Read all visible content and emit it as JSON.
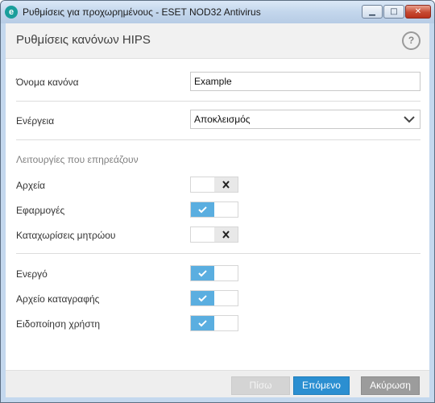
{
  "window": {
    "app_icon_letter": "e",
    "title": "Ρυθμίσεις για προχωρημένους - ESET NOD32 Antivirus",
    "minimize_glyph": "▁",
    "maximize_glyph": "□",
    "close_glyph": "✕"
  },
  "header": {
    "title": "Ρυθμίσεις κανόνων HIPS",
    "help_glyph": "?"
  },
  "form": {
    "rule_name_label": "Όνομα κανόνα",
    "rule_name_value": "Example",
    "action_label": "Ενέργεια",
    "action_value": "Αποκλεισμός"
  },
  "affected": {
    "section_title": "Λειτουργίες που επηρεάζουν",
    "items": [
      {
        "label": "Αρχεία",
        "enabled": false
      },
      {
        "label": "Εφαρμογές",
        "enabled": true
      },
      {
        "label": "Καταχωρίσεις μητρώου",
        "enabled": false
      }
    ]
  },
  "options": {
    "items": [
      {
        "label": "Ενεργό",
        "enabled": true
      },
      {
        "label": "Αρχείο καταγραφής",
        "enabled": true
      },
      {
        "label": "Ειδοποίηση χρήστη",
        "enabled": true
      }
    ]
  },
  "footer": {
    "back_label": "Πίσω",
    "next_label": "Επόμενο",
    "cancel_label": "Ακύρωση"
  },
  "colors": {
    "accent": "#2b8fd1",
    "toggle_on": "#5aaee0",
    "toggle_off": "#e8e8e8"
  }
}
